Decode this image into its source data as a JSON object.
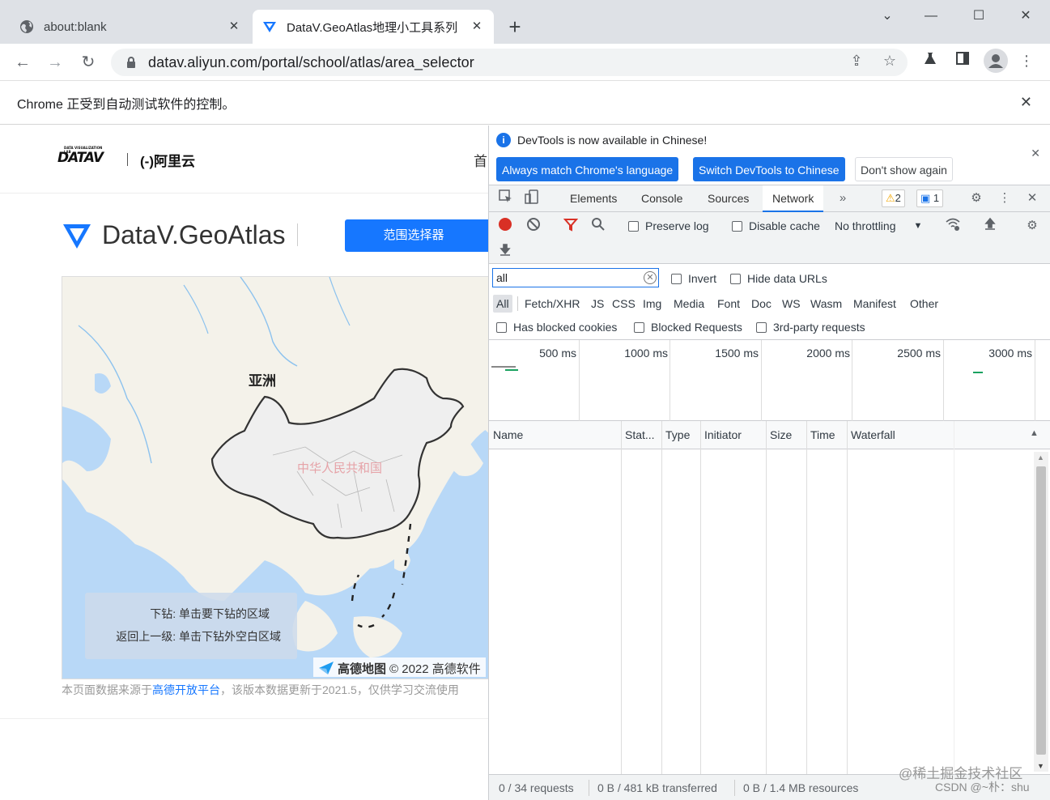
{
  "tabs": [
    {
      "label": "about:blank",
      "active": false
    },
    {
      "label": "DataV.GeoAtlas地理小工具系列",
      "active": true
    }
  ],
  "toolbar": {
    "url": "datav.aliyun.com/portal/school/atlas/area_selector"
  },
  "infobar": {
    "text": "Chrome 正受到自动测试软件的控制。"
  },
  "page": {
    "brand_datav": "DATAV",
    "brand_datav_small": "DATA VISUALIZATION LAB",
    "brand_aliyun": "(-)阿里云",
    "nav_first": "首",
    "title": "DataV.GeoAtlas",
    "range_button": "范围选择器",
    "map": {
      "continent_label": "亚洲",
      "country_label": "中华人民共和国",
      "tip_drill": "下钻:   单击要下钻的区域",
      "tip_back": "返回上一级:   单击下钻外空白区域",
      "attribution_brand": "高德地图",
      "attribution": "© 2022 高德软件",
      "colors": {
        "sea": "#b8d8f7",
        "land": "#f4f2ea",
        "china": "#efefef",
        "river": "#8cc2ee"
      }
    },
    "footer_prefix": "本页面数据来源于",
    "footer_link": "高德开放平台",
    "footer_suffix": "，该版本数据更新于2021.5，仅供学习交流使用"
  },
  "devtools": {
    "info_message": "DevTools is now available in Chinese!",
    "btn_match": "Always match Chrome's language",
    "btn_switch": "Switch DevTools to Chinese",
    "btn_dont_show": "Don't show again",
    "tabs": [
      "Elements",
      "Console",
      "Sources",
      "Network"
    ],
    "active_tab": "Network",
    "warnings": "2",
    "messages": "1",
    "preserve_log": "Preserve log",
    "disable_cache": "Disable cache",
    "throttling": "No throttling",
    "filter_value": "all",
    "invert": "Invert",
    "hide_data_urls": "Hide data URLs",
    "types": [
      "All",
      "Fetch/XHR",
      "JS",
      "CSS",
      "Img",
      "Media",
      "Font",
      "Doc",
      "WS",
      "Wasm",
      "Manifest",
      "Other"
    ],
    "has_blocked_cookies": "Has blocked cookies",
    "blocked_requests": "Blocked Requests",
    "third_party": "3rd-party requests",
    "ticks": [
      "500 ms",
      "1000 ms",
      "1500 ms",
      "2000 ms",
      "2500 ms",
      "3000 ms"
    ],
    "columns": [
      "Name",
      "Stat...",
      "Type",
      "Initiator",
      "Size",
      "Time",
      "Waterfall"
    ],
    "status_requests": "0 / 34 requests",
    "status_transferred": "0 B / 481 kB transferred",
    "status_resources": "0 B / 1.4 MB resources",
    "accent": "#1a73e8"
  },
  "watermark": {
    "line1": "@稀土掘金技术社区",
    "line2": "CSDN @~朴：shu"
  }
}
